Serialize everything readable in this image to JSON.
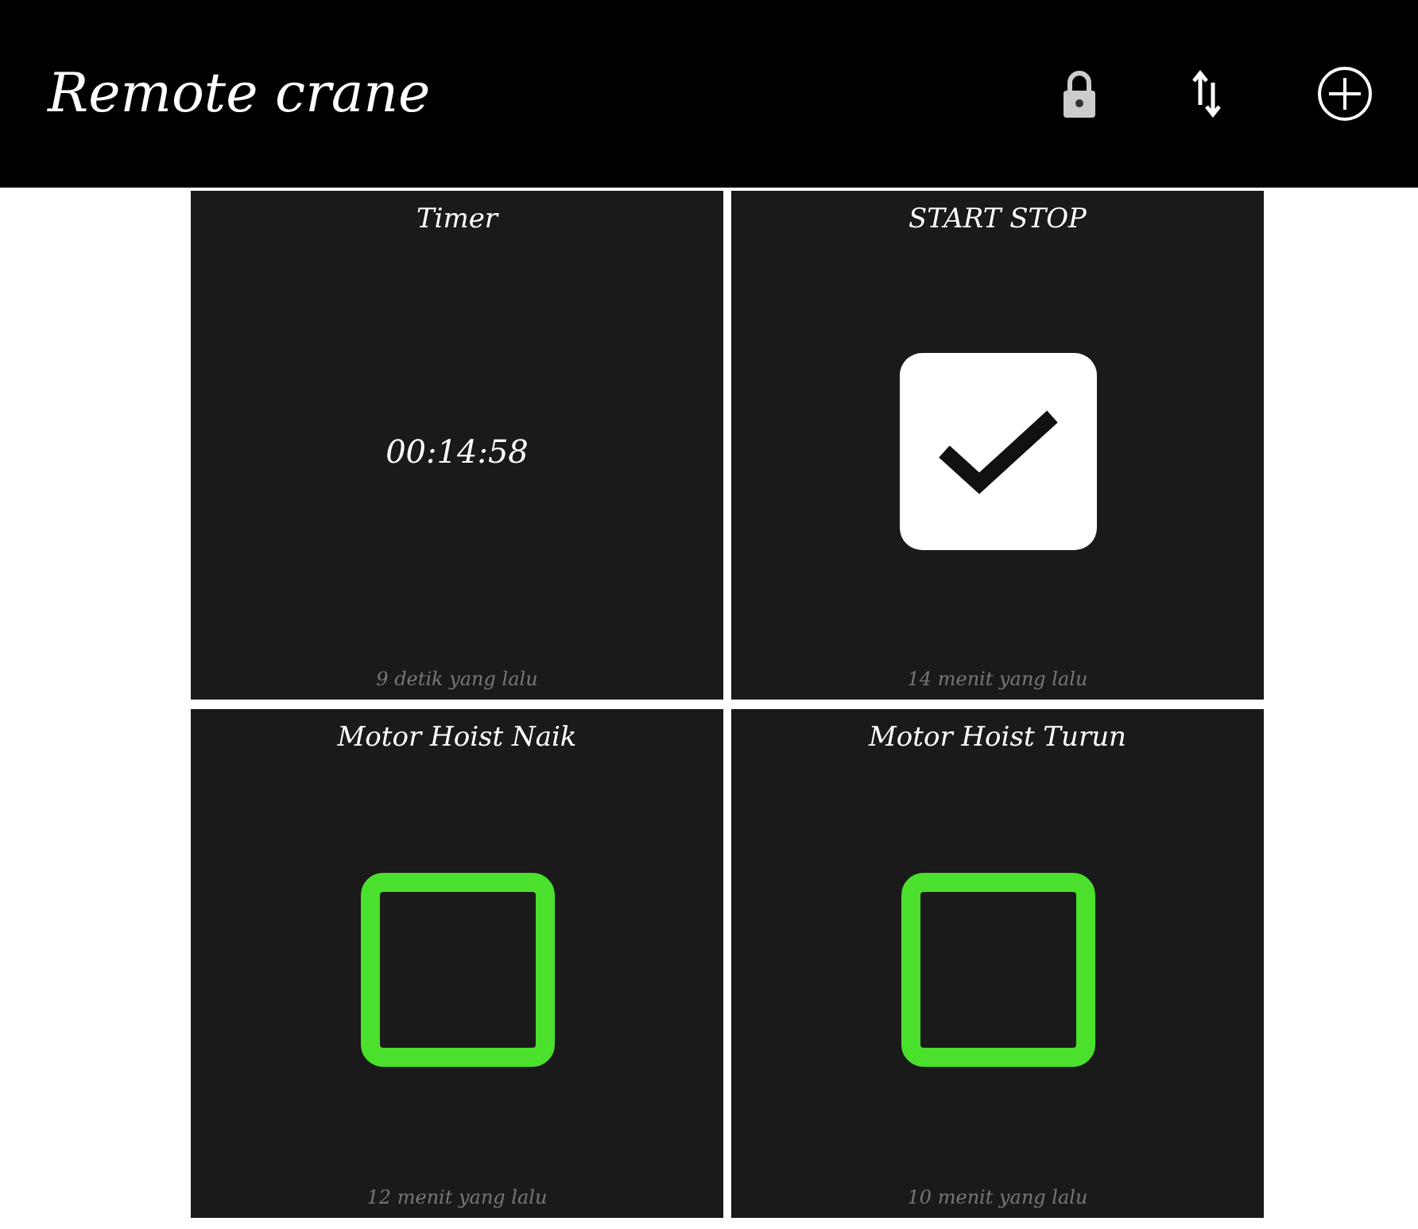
{
  "app_bar": {
    "title": "Remote crane"
  },
  "tiles": [
    {
      "kind": "timer",
      "title": "Timer",
      "value": "00:14:58",
      "footer": "9 detik yang lalu"
    },
    {
      "kind": "switch",
      "title": "START STOP",
      "checked": true,
      "footer": "14 menit yang lalu"
    },
    {
      "kind": "switch",
      "title": "Motor Hoist Naik",
      "checked": false,
      "footer": "12 menit yang lalu"
    },
    {
      "kind": "switch",
      "title": "Motor Hoist Turun",
      "checked": false,
      "footer": "10 menit yang lalu"
    }
  ]
}
